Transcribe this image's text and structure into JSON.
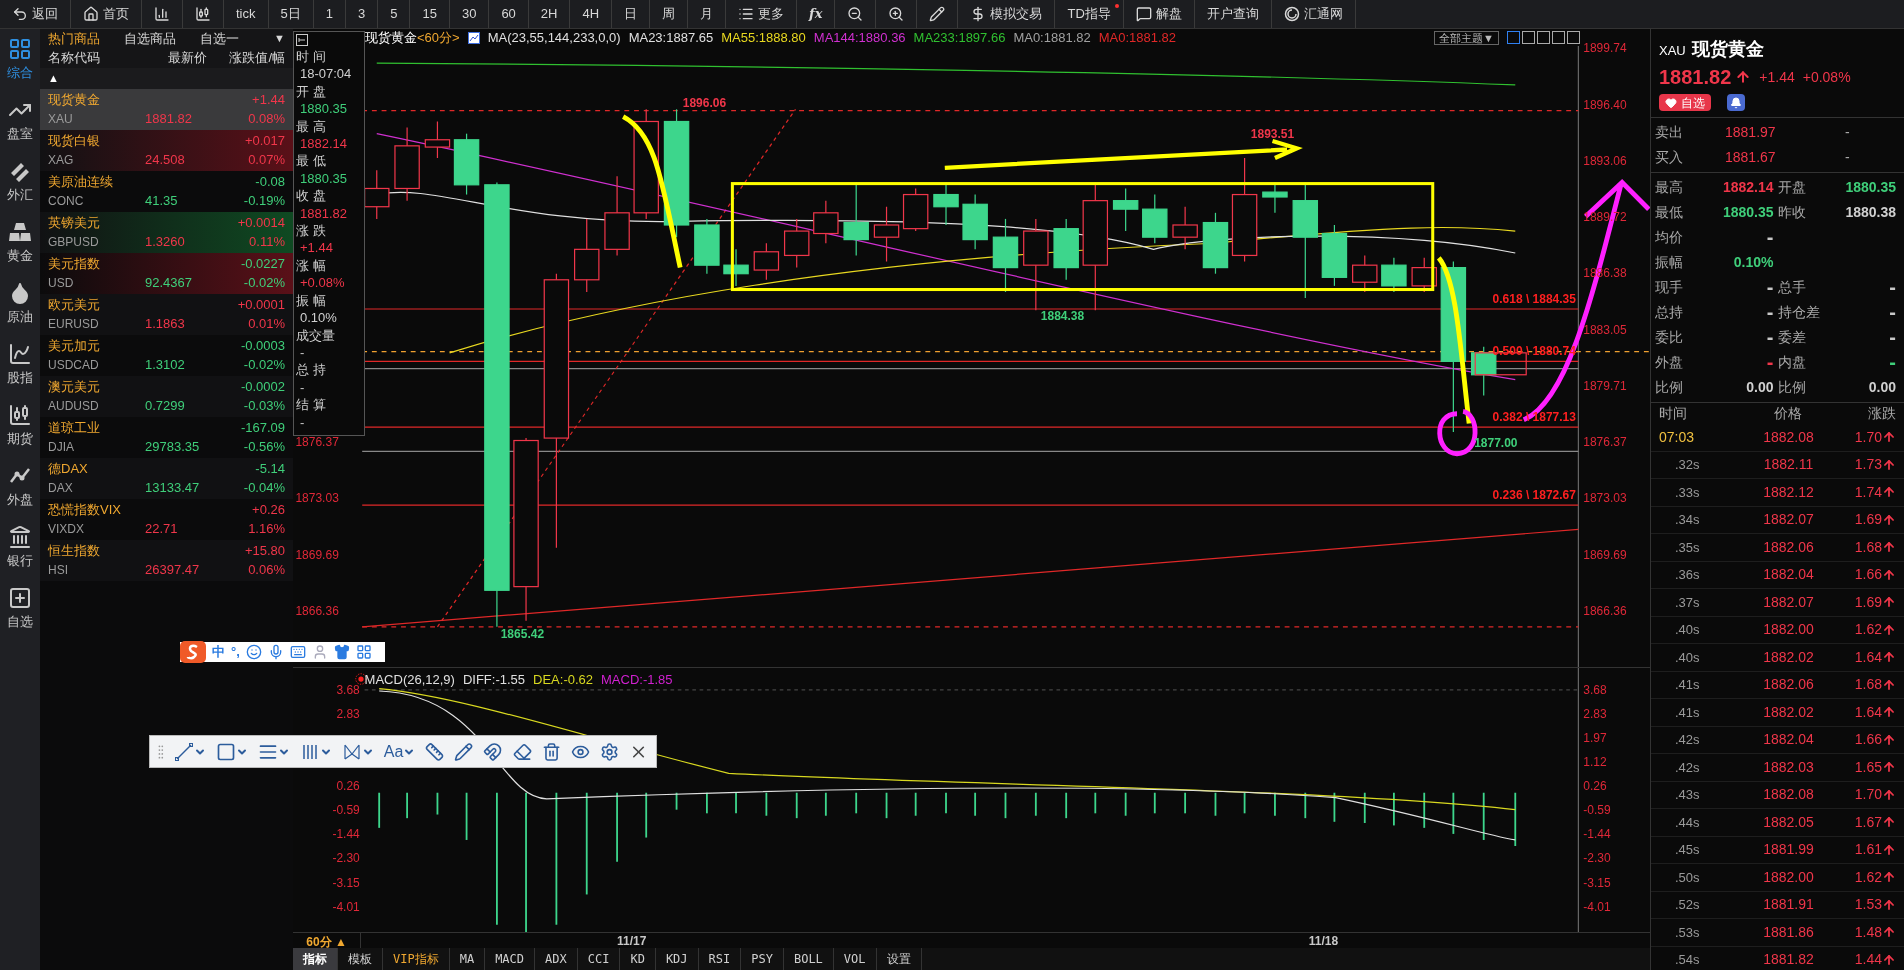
{
  "toolbar": [
    {
      "kind": "back",
      "label": "返回"
    },
    {
      "kind": "home",
      "label": "首页"
    },
    {
      "kind": "bars"
    },
    {
      "kind": "candles"
    },
    {
      "kind": "text",
      "label": "tick"
    },
    {
      "kind": "text",
      "label": "5日"
    },
    {
      "kind": "text",
      "label": "1"
    },
    {
      "kind": "text",
      "label": "3"
    },
    {
      "kind": "text",
      "label": "5"
    },
    {
      "kind": "text",
      "label": "15"
    },
    {
      "kind": "text",
      "label": "30"
    },
    {
      "kind": "text",
      "label": "60"
    },
    {
      "kind": "text",
      "label": "2H"
    },
    {
      "kind": "text",
      "label": "4H"
    },
    {
      "kind": "text",
      "label": "日"
    },
    {
      "kind": "text",
      "label": "周"
    },
    {
      "kind": "text",
      "label": "月"
    },
    {
      "kind": "list",
      "label": "更多"
    },
    {
      "kind": "fx",
      "label": "fx"
    },
    {
      "kind": "zoomout"
    },
    {
      "kind": "zoomin"
    },
    {
      "kind": "pen"
    },
    {
      "kind": "dollar",
      "label": "模拟交易"
    },
    {
      "kind": "dot",
      "label": "TD指导"
    },
    {
      "kind": "chat",
      "label": "解盘"
    },
    {
      "kind": "text",
      "label": "开户查询"
    },
    {
      "kind": "swirl",
      "label": "汇通网"
    }
  ],
  "nav": [
    {
      "kind": "grid",
      "label": "综合",
      "selected": true
    },
    {
      "kind": "trend",
      "label": "盘室",
      "selected": false
    },
    {
      "kind": "forex",
      "label": "外汇",
      "selected": false
    },
    {
      "kind": "gold",
      "label": "黄金",
      "selected": false
    },
    {
      "kind": "oil",
      "label": "原油",
      "selected": false
    },
    {
      "kind": "index",
      "label": "股指",
      "selected": false
    },
    {
      "kind": "futures",
      "label": "期货",
      "selected": false
    },
    {
      "kind": "outer",
      "label": "外盘",
      "selected": false
    },
    {
      "kind": "bank",
      "label": "银行",
      "selected": false
    },
    {
      "kind": "plus",
      "label": "自选",
      "selected": false
    }
  ],
  "watchlist": {
    "tabs": [
      {
        "label": "热门商品",
        "selected": true
      },
      {
        "label": "自选商品",
        "selected": false
      },
      {
        "label": "自选一",
        "selected": false
      }
    ],
    "dropdown": "▼",
    "columns": [
      "名称代码",
      "最新价",
      "涨跌值/幅"
    ],
    "sort_mark": "▲",
    "rows": [
      {
        "name": "现货黄金",
        "code": "XAU",
        "price": "1881.82",
        "change": "+1.44",
        "pct": "0.08%",
        "color": "#f0364a",
        "flash_up": false,
        "flash_down": false,
        "selected": true
      },
      {
        "name": "现货白银",
        "code": "XAG",
        "price": "24.508",
        "change": "+0.017",
        "pct": "0.07%",
        "color": "#f0364a",
        "flash_up": true,
        "flash_down": false,
        "selected": false
      },
      {
        "name": "美原油连续",
        "code": "CONC",
        "price": "41.35",
        "change": "-0.08",
        "pct": "-0.19%",
        "color": "#3fcf7a",
        "flash_up": false,
        "flash_down": false,
        "selected": false
      },
      {
        "name": "英镑美元",
        "code": "GBPUSD",
        "price": "1.3260",
        "change": "+0.0014",
        "pct": "0.11%",
        "color": "#f0364a",
        "flash_up": false,
        "flash_down": true,
        "selected": false
      },
      {
        "name": "美元指数",
        "code": "USD",
        "price": "92.4367",
        "change": "-0.0227",
        "pct": "-0.02%",
        "color": "#3fcf7a",
        "flash_up": true,
        "flash_down": false,
        "selected": false
      },
      {
        "name": "欧元美元",
        "code": "EURUSD",
        "price": "1.1863",
        "change": "+0.0001",
        "pct": "0.01%",
        "color": "#f0364a",
        "flash_up": false,
        "flash_down": false,
        "selected": false
      },
      {
        "name": "美元加元",
        "code": "USDCAD",
        "price": "1.3102",
        "change": "-0.0003",
        "pct": "-0.02%",
        "color": "#3fcf7a",
        "flash_up": false,
        "flash_down": false,
        "selected": false
      },
      {
        "name": "澳元美元",
        "code": "AUDUSD",
        "price": "0.7299",
        "change": "-0.0002",
        "pct": "-0.03%",
        "color": "#3fcf7a",
        "flash_up": false,
        "flash_down": false,
        "selected": false
      },
      {
        "name": "道琼工业",
        "code": "DJIA",
        "price": "29783.35",
        "change": "-167.09",
        "pct": "-0.56%",
        "color": "#3fcf7a",
        "flash_up": false,
        "flash_down": false,
        "selected": false
      },
      {
        "name": "德DAX",
        "code": "DAX",
        "price": "13133.47",
        "change": "-5.14",
        "pct": "-0.04%",
        "color": "#3fcf7a",
        "flash_up": false,
        "flash_down": false,
        "selected": false
      },
      {
        "name": "恐慌指数VIX",
        "code": "VIXDX",
        "price": "22.71",
        "change": "+0.26",
        "pct": "1.16%",
        "color": "#f0364a",
        "flash_up": false,
        "flash_down": false,
        "selected": false
      },
      {
        "name": "恒生指数",
        "code": "HSI",
        "price": "26397.47",
        "change": "+15.80",
        "pct": "0.06%",
        "color": "#f0364a",
        "flash_up": false,
        "flash_down": false,
        "selected": false
      }
    ]
  },
  "info_box": [
    {
      "label": "时 间",
      "value": "18-07:04",
      "color": "#d0d0d0"
    },
    {
      "label": "开 盘",
      "value": "1880.35",
      "color": "#3fcf7a"
    },
    {
      "label": "最 高",
      "value": "1882.14",
      "color": "#f0364a"
    },
    {
      "label": "最 低",
      "value": "1880.35",
      "color": "#3fcf7a"
    },
    {
      "label": "收 盘",
      "value": "1881.82",
      "color": "#f0364a"
    },
    {
      "label": "涨 跌",
      "value": "+1.44",
      "color": "#f0364a"
    },
    {
      "label": "涨 幅",
      "value": "+0.08%",
      "color": "#f0364a"
    },
    {
      "label": "振 幅",
      "value": "0.10%",
      "color": "#d0d0d0"
    },
    {
      "label": "成交量",
      "value": "-"
    },
    {
      "label": "总 持",
      "value": "-"
    },
    {
      "label": "结 算",
      "value": "-"
    }
  ],
  "chart": {
    "title": "现货黄金",
    "period": "<60分>",
    "legend": [
      {
        "text": "MA(23,55,144,233,0,0)",
        "color": "#e0e0e0"
      },
      {
        "text": "MA23:1887.65",
        "color": "#e0e0e0"
      },
      {
        "text": "MA55:1888.80",
        "color": "#e8d820"
      },
      {
        "text": "MA144:1880.36",
        "color": "#d030d0"
      },
      {
        "text": "MA233:1897.66",
        "color": "#30c030"
      },
      {
        "text": "MA0:1881.82",
        "color": "#a0a0a0"
      },
      {
        "text": "MA0:1881.82",
        "color": "#e02828"
      }
    ],
    "theme_button": "全部主题▼",
    "right_ticks": [
      "1899.74",
      "1896.40",
      "1893.06",
      "1889.72",
      "1886.38",
      "1883.05",
      "1879.71",
      "1876.37",
      "1873.03",
      "1869.69",
      "1866.36"
    ],
    "left_ticks": [
      "1876.37",
      "1873.03",
      "1869.69",
      "1866.36"
    ],
    "fib_labels": [
      "0.618 \\ 1884.35",
      "0.500 \\ 1880.74",
      "0.382 \\ 1877.13",
      "0.236 \\ 1872.67"
    ],
    "points": [
      {
        "text": "1896.06",
        "color": "#f0364a"
      },
      {
        "text": "1893.51",
        "color": "#f0364a"
      },
      {
        "text": "1884.38",
        "color": "#3fcf7a"
      },
      {
        "text": "1865.42",
        "color": "#3fcf7a"
      },
      {
        "text": "1877.00",
        "color": "#3fcf7a"
      }
    ]
  },
  "macd": {
    "legend": [
      {
        "text": "MACD(26,12,9)",
        "color": "#e0e0e0"
      },
      {
        "text": "DIFF:-1.55",
        "color": "#e0e0e0"
      },
      {
        "text": "DEA:-0.62",
        "color": "#d8d820"
      },
      {
        "text": "MACD:-1.85",
        "color": "#d020d0"
      }
    ],
    "left_ticks": [
      "3.68",
      "2.83",
      "0.26",
      "-0.59",
      "-1.44",
      "-2.30",
      "-3.15",
      "-4.01"
    ],
    "right_ticks": [
      "3.68",
      "2.83",
      "1.97",
      "1.12",
      "0.26",
      "-0.59",
      "-1.44",
      "-2.30",
      "-3.15",
      "-4.01"
    ]
  },
  "period_button": "60分 ▲",
  "dates": [
    "11/17",
    "11/18"
  ],
  "bottom_tabs": [
    {
      "label": "指标",
      "kind": "plain",
      "selected": true
    },
    {
      "label": "模板",
      "kind": "plain",
      "selected": false
    },
    {
      "label": "VIP指标",
      "kind": "vip",
      "selected": false
    },
    {
      "label": "MA",
      "kind": "plain",
      "selected": false
    },
    {
      "label": "MACD",
      "kind": "plain",
      "selected": false
    },
    {
      "label": "ADX",
      "kind": "plain",
      "selected": false
    },
    {
      "label": "CCI",
      "kind": "plain",
      "selected": false
    },
    {
      "label": "KD",
      "kind": "plain",
      "selected": false
    },
    {
      "label": "KDJ",
      "kind": "plain",
      "selected": false
    },
    {
      "label": "RSI",
      "kind": "plain",
      "selected": false
    },
    {
      "label": "PSY",
      "kind": "plain",
      "selected": false
    },
    {
      "label": "BOLL",
      "kind": "plain",
      "selected": false
    },
    {
      "label": "VOL",
      "kind": "plain",
      "selected": false
    },
    {
      "label": "设置",
      "kind": "plain",
      "selected": false
    }
  ],
  "quote": {
    "code": "XAU",
    "name": "现货黄金",
    "price": "1881.82",
    "change": "+1.44",
    "pct": "+0.08%",
    "watch_button": "自选",
    "book": [
      {
        "label": "卖出",
        "value": "1881.97",
        "extra": "-"
      },
      {
        "label": "买入",
        "value": "1881.67",
        "extra": "-"
      }
    ],
    "stats": [
      [
        {
          "label": "最高",
          "value": "1882.14",
          "color": "#f0364a"
        },
        {
          "label": "开盘",
          "value": "1880.35",
          "color": "#3fcf7a"
        }
      ],
      [
        {
          "label": "最低",
          "value": "1880.35",
          "color": "#3fcf7a"
        },
        {
          "label": "昨收",
          "value": "1880.38",
          "color": "#d0d0d0"
        }
      ],
      [
        {
          "label": "均价",
          "value": "-"
        }
      ],
      [
        {
          "label": "振幅",
          "value": "0.10%",
          "color": "#3fcf7a"
        }
      ],
      [
        {
          "label": "现手",
          "value": "-"
        },
        {
          "label": "总手",
          "value": "-"
        }
      ],
      [
        {
          "label": "总持",
          "value": "-"
        },
        {
          "label": "持仓差",
          "value": "-"
        }
      ],
      [
        {
          "label": "委比",
          "value": "-"
        },
        {
          "label": "委差",
          "value": "-"
        }
      ],
      [
        {
          "label": "外盘",
          "value": "-",
          "color": "#f0364a"
        },
        {
          "label": "内盘",
          "value": "-",
          "color": "#3fcf7a"
        }
      ],
      [
        {
          "label": "比例",
          "value": "0.00",
          "color": "#d0d0d0"
        },
        {
          "label": "比例",
          "value": "0.00",
          "color": "#d0d0d0"
        }
      ]
    ],
    "tick_columns": [
      "时间",
      "价格",
      "涨跌"
    ],
    "ticks": [
      {
        "kind": "minute",
        "time": "07:03",
        "price": "1882.08",
        "change": "1.70"
      },
      {
        "kind": "second",
        "time": ".32s",
        "price": "1882.11",
        "change": "1.73"
      },
      {
        "kind": "second",
        "time": ".33s",
        "price": "1882.12",
        "change": "1.74"
      },
      {
        "kind": "second",
        "time": ".34s",
        "price": "1882.07",
        "change": "1.69"
      },
      {
        "kind": "second",
        "time": ".35s",
        "price": "1882.06",
        "change": "1.68"
      },
      {
        "kind": "second",
        "time": ".36s",
        "price": "1882.04",
        "change": "1.66"
      },
      {
        "kind": "second",
        "time": ".37s",
        "price": "1882.07",
        "change": "1.69"
      },
      {
        "kind": "second",
        "time": ".40s",
        "price": "1882.00",
        "change": "1.62"
      },
      {
        "kind": "second",
        "time": ".40s",
        "price": "1882.02",
        "change": "1.64"
      },
      {
        "kind": "second",
        "time": ".41s",
        "price": "1882.06",
        "change": "1.68"
      },
      {
        "kind": "second",
        "time": ".41s",
        "price": "1882.02",
        "change": "1.64"
      },
      {
        "kind": "second",
        "time": ".42s",
        "price": "1882.04",
        "change": "1.66"
      },
      {
        "kind": "second",
        "time": ".42s",
        "price": "1882.03",
        "change": "1.65"
      },
      {
        "kind": "second",
        "time": ".43s",
        "price": "1882.08",
        "change": "1.70"
      },
      {
        "kind": "second",
        "time": ".44s",
        "price": "1882.05",
        "change": "1.67"
      },
      {
        "kind": "second",
        "time": ".45s",
        "price": "1881.99",
        "change": "1.61"
      },
      {
        "kind": "second",
        "time": ".50s",
        "price": "1882.00",
        "change": "1.62"
      },
      {
        "kind": "second",
        "time": ".52s",
        "price": "1881.91",
        "change": "1.53"
      },
      {
        "kind": "second",
        "time": ".53s",
        "price": "1881.86",
        "change": "1.48"
      },
      {
        "kind": "second",
        "time": ".54s",
        "price": "1881.82",
        "change": "1.44"
      }
    ]
  },
  "ime_bar": {
    "mode": "中",
    "punct": "°,"
  },
  "draw_toolbar": {
    "font_button": "Aa"
  }
}
